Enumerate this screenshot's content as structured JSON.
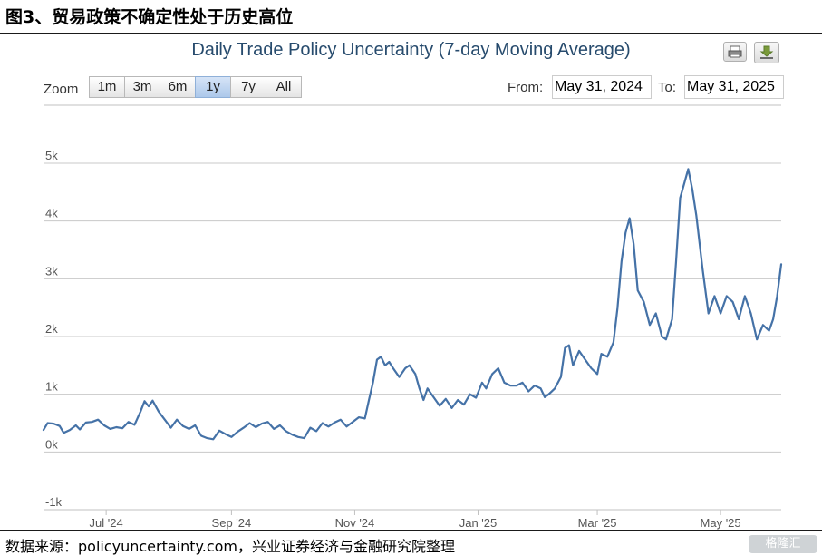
{
  "figure_title": "图3、贸易政策不确定性处于历史高位",
  "source_text": "数据来源：policyuncertainty.com，兴业证券经济与金融研究院整理",
  "watermark_text": "格隆汇",
  "toolbar": {
    "print_icon": "print-icon",
    "download_icon": "download-icon",
    "zoom_label": "Zoom",
    "range_buttons": [
      {
        "label": "1m",
        "active": false
      },
      {
        "label": "3m",
        "active": false
      },
      {
        "label": "6m",
        "active": false
      },
      {
        "label": "1y",
        "active": true
      },
      {
        "label": "7y",
        "active": false
      },
      {
        "label": "All",
        "active": false
      }
    ],
    "from_label": "From:",
    "from_value": "May 31, 2024",
    "to_label": "To:",
    "to_value": "May 31, 2025"
  },
  "colors": {
    "line": "#4572a7",
    "title": "#274b6d",
    "grid": "#c8c8c8",
    "active_button": "#acc8ea"
  },
  "chart_data": {
    "type": "line",
    "title": "Daily Trade Policy Uncertainty (7-day Moving Average)",
    "xlabel": "",
    "ylabel": "",
    "ylim": [
      -1000,
      5000
    ],
    "yticks": [
      -1000,
      0,
      1000,
      2000,
      3000,
      4000,
      5000
    ],
    "ytick_labels": [
      "-1k",
      "0k",
      "1k",
      "2k",
      "3k",
      "4k",
      "5k"
    ],
    "xlim": [
      "2024-05-31",
      "2025-05-31"
    ],
    "xticks": [
      "2024-07-01",
      "2024-09-01",
      "2024-11-01",
      "2025-01-01",
      "2025-03-01",
      "2025-05-01"
    ],
    "xtick_labels": [
      "Jul '24",
      "Sep '24",
      "Nov '24",
      "Jan '25",
      "Mar '25",
      "May '25"
    ],
    "grid": true,
    "legend": "none",
    "series": [
      {
        "values": [
          [
            "2024-05-31",
            380
          ],
          [
            "2024-06-02",
            500
          ],
          [
            "2024-06-05",
            490
          ],
          [
            "2024-06-08",
            450
          ],
          [
            "2024-06-10",
            330
          ],
          [
            "2024-06-13",
            380
          ],
          [
            "2024-06-16",
            460
          ],
          [
            "2024-06-18",
            390
          ],
          [
            "2024-06-21",
            510
          ],
          [
            "2024-06-24",
            520
          ],
          [
            "2024-06-27",
            560
          ],
          [
            "2024-06-30",
            460
          ],
          [
            "2024-07-03",
            400
          ],
          [
            "2024-07-06",
            430
          ],
          [
            "2024-07-09",
            410
          ],
          [
            "2024-07-12",
            520
          ],
          [
            "2024-07-15",
            470
          ],
          [
            "2024-07-18",
            700
          ],
          [
            "2024-07-20",
            880
          ],
          [
            "2024-07-22",
            790
          ],
          [
            "2024-07-24",
            890
          ],
          [
            "2024-07-27",
            700
          ],
          [
            "2024-07-30",
            560
          ],
          [
            "2024-08-02",
            420
          ],
          [
            "2024-08-05",
            560
          ],
          [
            "2024-08-08",
            450
          ],
          [
            "2024-08-11",
            400
          ],
          [
            "2024-08-14",
            460
          ],
          [
            "2024-08-17",
            280
          ],
          [
            "2024-08-20",
            240
          ],
          [
            "2024-08-23",
            220
          ],
          [
            "2024-08-26",
            370
          ],
          [
            "2024-08-29",
            310
          ],
          [
            "2024-09-01",
            260
          ],
          [
            "2024-09-04",
            350
          ],
          [
            "2024-09-07",
            420
          ],
          [
            "2024-09-10",
            500
          ],
          [
            "2024-09-13",
            430
          ],
          [
            "2024-09-16",
            490
          ],
          [
            "2024-09-19",
            520
          ],
          [
            "2024-09-22",
            400
          ],
          [
            "2024-09-25",
            460
          ],
          [
            "2024-09-28",
            360
          ],
          [
            "2024-10-01",
            300
          ],
          [
            "2024-10-04",
            260
          ],
          [
            "2024-10-07",
            240
          ],
          [
            "2024-10-10",
            420
          ],
          [
            "2024-10-13",
            360
          ],
          [
            "2024-10-16",
            500
          ],
          [
            "2024-10-19",
            440
          ],
          [
            "2024-10-22",
            510
          ],
          [
            "2024-10-25",
            560
          ],
          [
            "2024-10-28",
            440
          ],
          [
            "2024-10-31",
            520
          ],
          [
            "2024-11-03",
            600
          ],
          [
            "2024-11-06",
            580
          ],
          [
            "2024-11-08",
            900
          ],
          [
            "2024-11-10",
            1200
          ],
          [
            "2024-11-12",
            1600
          ],
          [
            "2024-11-14",
            1650
          ],
          [
            "2024-11-16",
            1500
          ],
          [
            "2024-11-18",
            1560
          ],
          [
            "2024-11-20",
            1450
          ],
          [
            "2024-11-23",
            1300
          ],
          [
            "2024-11-26",
            1450
          ],
          [
            "2024-11-28",
            1500
          ],
          [
            "2024-12-01",
            1350
          ],
          [
            "2024-12-03",
            1100
          ],
          [
            "2024-12-05",
            900
          ],
          [
            "2024-12-07",
            1100
          ],
          [
            "2024-12-10",
            950
          ],
          [
            "2024-12-13",
            800
          ],
          [
            "2024-12-16",
            920
          ],
          [
            "2024-12-19",
            760
          ],
          [
            "2024-12-22",
            900
          ],
          [
            "2024-12-25",
            820
          ],
          [
            "2024-12-28",
            1000
          ],
          [
            "2024-12-31",
            940
          ],
          [
            "2025-01-03",
            1200
          ],
          [
            "2025-01-05",
            1100
          ],
          [
            "2025-01-08",
            1350
          ],
          [
            "2025-01-11",
            1450
          ],
          [
            "2025-01-14",
            1200
          ],
          [
            "2025-01-17",
            1150
          ],
          [
            "2025-01-20",
            1150
          ],
          [
            "2025-01-23",
            1200
          ],
          [
            "2025-01-26",
            1050
          ],
          [
            "2025-01-29",
            1150
          ],
          [
            "2025-02-01",
            1100
          ],
          [
            "2025-02-03",
            950
          ],
          [
            "2025-02-05",
            1000
          ],
          [
            "2025-02-08",
            1100
          ],
          [
            "2025-02-11",
            1300
          ],
          [
            "2025-02-13",
            1800
          ],
          [
            "2025-02-15",
            1850
          ],
          [
            "2025-02-17",
            1500
          ],
          [
            "2025-02-20",
            1750
          ],
          [
            "2025-02-23",
            1600
          ],
          [
            "2025-02-26",
            1450
          ],
          [
            "2025-03-01",
            1350
          ],
          [
            "2025-03-03",
            1700
          ],
          [
            "2025-03-06",
            1650
          ],
          [
            "2025-03-09",
            1900
          ],
          [
            "2025-03-11",
            2500
          ],
          [
            "2025-03-13",
            3300
          ],
          [
            "2025-03-15",
            3800
          ],
          [
            "2025-03-17",
            4050
          ],
          [
            "2025-03-19",
            3600
          ],
          [
            "2025-03-21",
            2800
          ],
          [
            "2025-03-24",
            2600
          ],
          [
            "2025-03-27",
            2200
          ],
          [
            "2025-03-30",
            2400
          ],
          [
            "2025-04-02",
            2000
          ],
          [
            "2025-04-04",
            1950
          ],
          [
            "2025-04-07",
            2300
          ],
          [
            "2025-04-09",
            3300
          ],
          [
            "2025-04-11",
            4400
          ],
          [
            "2025-04-13",
            4650
          ],
          [
            "2025-04-15",
            4900
          ],
          [
            "2025-04-17",
            4550
          ],
          [
            "2025-04-19",
            4100
          ],
          [
            "2025-04-22",
            3200
          ],
          [
            "2025-04-25",
            2400
          ],
          [
            "2025-04-28",
            2700
          ],
          [
            "2025-05-01",
            2400
          ],
          [
            "2025-05-04",
            2700
          ],
          [
            "2025-05-07",
            2600
          ],
          [
            "2025-05-10",
            2300
          ],
          [
            "2025-05-13",
            2700
          ],
          [
            "2025-05-16",
            2400
          ],
          [
            "2025-05-19",
            1950
          ],
          [
            "2025-05-22",
            2200
          ],
          [
            "2025-05-25",
            2100
          ],
          [
            "2025-05-27",
            2300
          ],
          [
            "2025-05-29",
            2700
          ],
          [
            "2025-05-31",
            3250
          ]
        ]
      }
    ]
  }
}
